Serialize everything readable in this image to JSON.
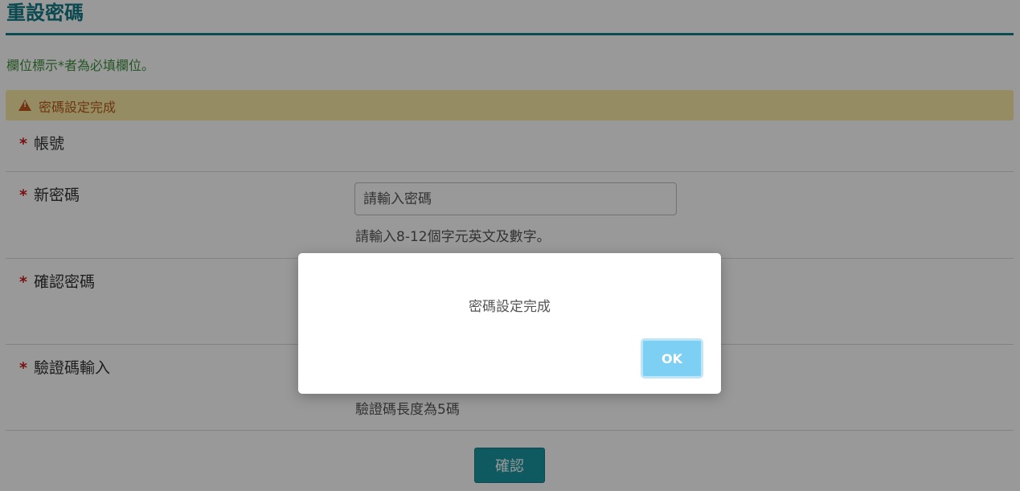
{
  "page": {
    "title": "重設密碼",
    "required_note": "欄位標示*者為必填欄位。"
  },
  "alert": {
    "icon": "warning-icon",
    "text": "密碼設定完成",
    "color": "#b35a1f",
    "background": "#fbe9a6"
  },
  "form": {
    "required_mark": "*",
    "account": {
      "label": "帳號"
    },
    "new_password": {
      "label": "新密碼",
      "placeholder": "請輸入密碼",
      "hint": "請輸入8-12個字元英文及數字。"
    },
    "confirm_password": {
      "label": "確認密碼"
    },
    "captcha": {
      "label": "驗證碼輸入",
      "hint": "驗證碼長度為5碼"
    },
    "submit_label": "確認"
  },
  "modal": {
    "message": "密碼設定完成",
    "ok_label": "OK"
  },
  "colors": {
    "accent": "#127a85",
    "button": "#1a96a2",
    "ok_button": "#7ecff4",
    "required_star": "#c81e1e"
  }
}
